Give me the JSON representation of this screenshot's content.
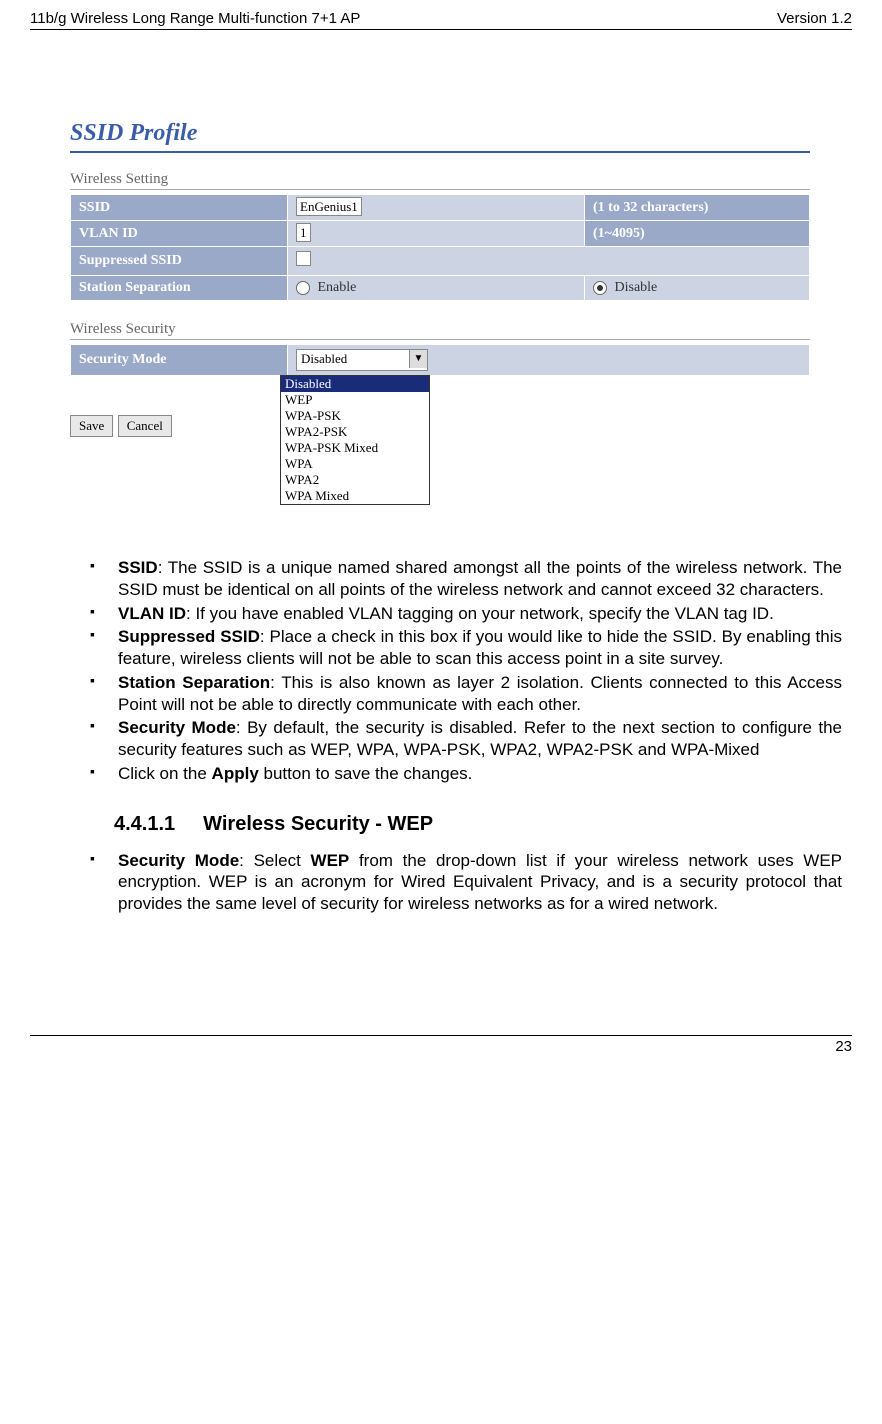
{
  "doc": {
    "header_left": "11b/g Wireless Long Range Multi-function 7+1 AP",
    "header_right": "Version 1.2",
    "page_number": "23"
  },
  "ss": {
    "title": "SSID Profile",
    "section1": "Wireless Setting",
    "section2": "Wireless Security",
    "rows": {
      "ssid_label": "SSID",
      "ssid_value": "EnGenius1",
      "ssid_hint": "(1 to 32 characters)",
      "vlan_label": "VLAN ID",
      "vlan_value": "1",
      "vlan_hint": "(1~4095)",
      "suppressed_label": "Suppressed SSID",
      "station_label": "Station Separation",
      "enable": "Enable",
      "disable": "Disable",
      "secmode_label": "Security Mode",
      "secmode_value": "Disabled"
    },
    "options": [
      "Disabled",
      "WEP",
      "WPA-PSK",
      "WPA2-PSK",
      "WPA-PSK Mixed",
      "WPA",
      "WPA2",
      "WPA Mixed"
    ],
    "buttons": {
      "save": "Save",
      "cancel": "Cancel"
    }
  },
  "bullets": [
    {
      "b": "SSID",
      "t": ": The SSID is a unique named shared amongst all the points of the wireless network. The SSID must be identical on all points of the wireless network and cannot exceed 32 characters."
    },
    {
      "b": "VLAN ID",
      "t": ": If you have enabled VLAN tagging on your network, specify the VLAN tag ID."
    },
    {
      "b": "Suppressed SSID",
      "t": ": Place a check in this box if you would like to hide the SSID. By enabling this feature, wireless clients will not be able to scan this access point in a site survey."
    },
    {
      "b": "Station Separation",
      "t": ": This is also known as layer 2 isolation. Clients connected to this Access Point will not be able to directly communicate with each other."
    },
    {
      "b": "Security Mode",
      "t": ": By default, the security is disabled. Refer to the next section to configure the security features such as WEP, WPA, WPA-PSK, WPA2, WPA2-PSK and WPA-Mixed"
    },
    {
      "b": "",
      "t": "Click on the ",
      "b2": "Apply",
      "t2": " button to save the changes."
    }
  ],
  "sec441": {
    "num": "4.4.1.1",
    "title": "Wireless Security - WEP",
    "bullet_b": "Security Mode",
    "bullet_t1": ": Select ",
    "bullet_b2": "WEP",
    "bullet_t2": " from the drop-down list if your wireless network uses WEP encryption. WEP is an acronym for Wired Equivalent Privacy, and is a security protocol that provides the same level of security for wireless networks as for a wired network."
  }
}
